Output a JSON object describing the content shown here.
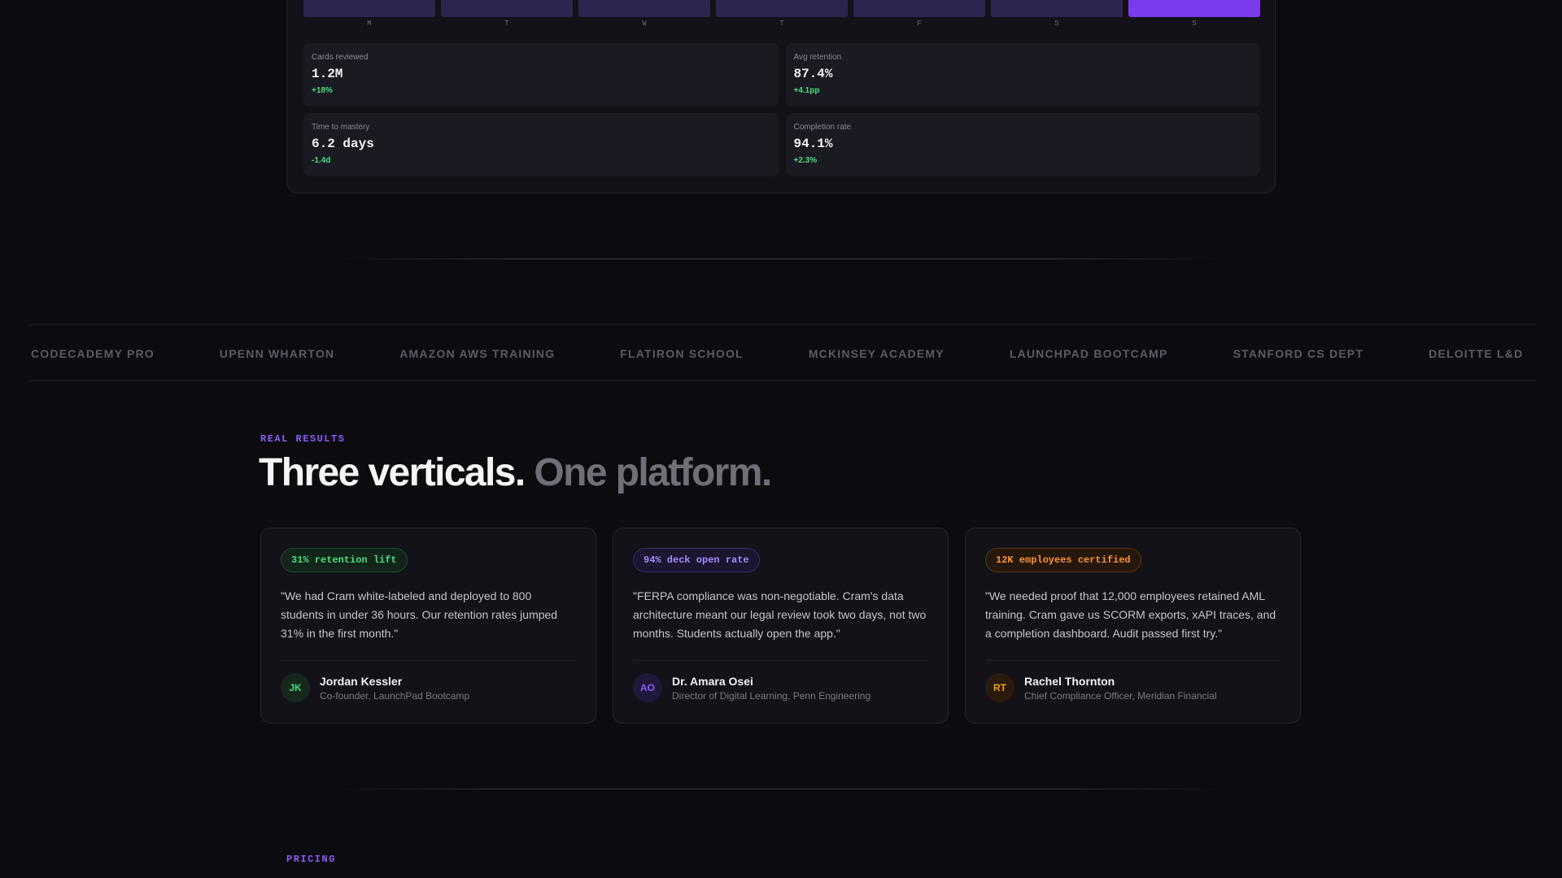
{
  "dashboard": {
    "days": [
      "M",
      "T",
      "W",
      "T",
      "F",
      "S",
      "S"
    ],
    "active_day_index": 6,
    "metrics": [
      {
        "label": "Cards reviewed",
        "value": "1.2M",
        "delta": "+18%"
      },
      {
        "label": "Avg retention",
        "value": "87.4%",
        "delta": "+4.1pp"
      },
      {
        "label": "Time to mastery",
        "value": "6.2 days",
        "delta": "-1.4d"
      },
      {
        "label": "Completion rate",
        "value": "94.1%",
        "delta": "+2.3%"
      }
    ]
  },
  "logos": [
    "CODECADEMY PRO",
    "UPENN WHARTON",
    "AMAZON AWS TRAINING",
    "FLATIRON SCHOOL",
    "MCKINSEY ACADEMY",
    "LAUNCHPAD BOOTCAMP",
    "STANFORD CS DEPT",
    "DELOITTE L&D"
  ],
  "results": {
    "eyebrow": "REAL RESULTS",
    "headline_main": "Three verticals.",
    "headline_muted": "One platform.",
    "cards": [
      {
        "badge": "31% retention lift",
        "quote": "\"We had Cram white-labeled and deployed to 800 students in under 36 hours. Our retention rates jumped 31% in the first month.\"",
        "initials": "JK",
        "name": "Jordan Kessler",
        "role": "Co-founder, LaunchPad Bootcamp",
        "accent": "#4ade80"
      },
      {
        "badge": "94% deck open rate",
        "quote": "\"FERPA compliance was non-negotiable. Cram's data architecture meant our legal review took two days, not two months. Students actually open the app.\"",
        "initials": "AO",
        "name": "Dr. Amara Osei",
        "role": "Director of Digital Learning, Penn Engineering",
        "accent": "#8b5cf6"
      },
      {
        "badge": "12K employees certified",
        "quote": "\"We needed proof that 12,000 employees retained AML training. Cram gave us SCORM exports, xAPI traces, and a completion dashboard. Audit passed first try.\"",
        "initials": "RT",
        "name": "Rachel Thornton",
        "role": "Chief Compliance Officer, Meridian Financial",
        "accent": "#f59e0b"
      }
    ]
  },
  "pricing": {
    "eyebrow": "PRICING"
  }
}
